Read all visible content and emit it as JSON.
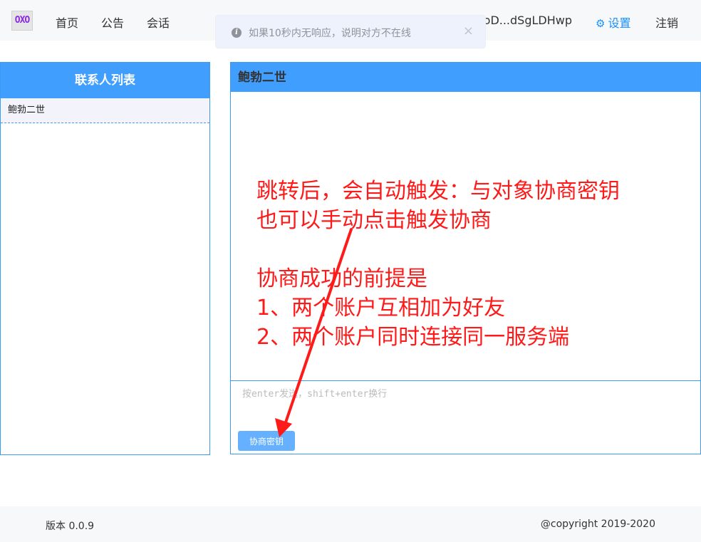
{
  "header": {
    "logo_text": "OXO",
    "nav": [
      "首页",
      "公告",
      "会话"
    ],
    "user_name": "…toD...dSgLDHwp",
    "settings_label": "设置",
    "logout_label": "注销"
  },
  "toast": {
    "message": "如果10秒内无响应，说明对方不在线",
    "close_symbol": "×"
  },
  "contacts": {
    "title": "联系人列表",
    "items": [
      "鲍勃二世"
    ]
  },
  "chat": {
    "peer_name": "鲍勃二世",
    "input_placeholder": "按enter发送，shift+enter换行",
    "negotiate_button": "协商密钥"
  },
  "annotation": {
    "lines": [
      "跳转后，会自动触发：与对象协商密钥",
      "也可以手动点击触发协商",
      "协商成功的前提是",
      "1、两个账户互相加为好友",
      "2、两个账户同时连接同一服务端"
    ],
    "color": "#ff1a1a"
  },
  "footer": {
    "version": "版本 0.0.9",
    "copyright": "@copyright 2019-2020"
  },
  "colors": {
    "primary": "#409eff",
    "button": "#66b1ff",
    "accent_link": "#1890ff"
  }
}
